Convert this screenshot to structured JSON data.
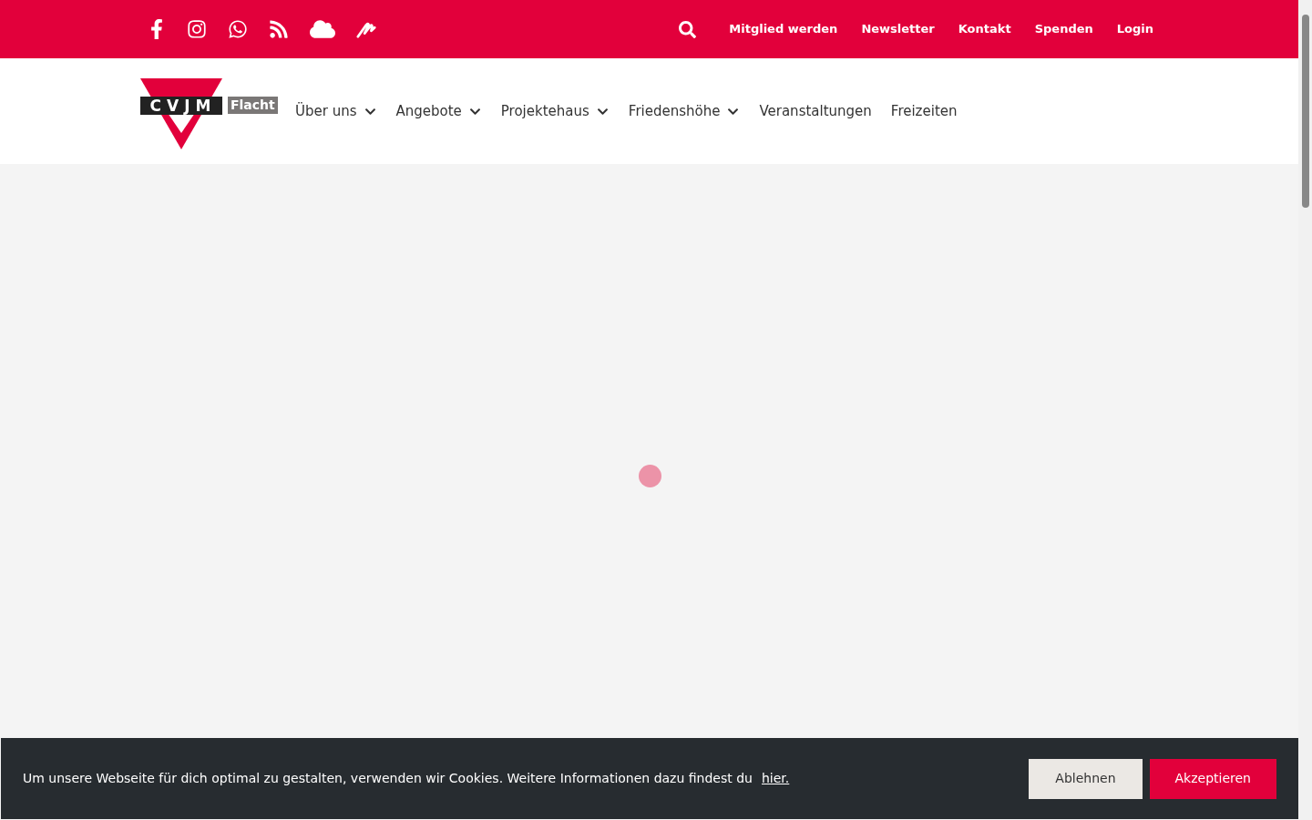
{
  "top_bar": {
    "social_icons": [
      {
        "kind": "facebook"
      },
      {
        "kind": "instagram"
      },
      {
        "kind": "whatsapp"
      },
      {
        "kind": "rss"
      },
      {
        "kind": "cloud"
      },
      {
        "kind": "signature"
      }
    ],
    "links": [
      "Mitglied werden",
      "Newsletter",
      "Kontakt",
      "Spenden",
      "Login"
    ]
  },
  "logo": {
    "mark": "CVJM",
    "place": "Flacht"
  },
  "nav": [
    {
      "label": "Über uns",
      "dropdown": true
    },
    {
      "label": "Angebote",
      "dropdown": true
    },
    {
      "label": "Projektehaus",
      "dropdown": true
    },
    {
      "label": "Friedenshöhe",
      "dropdown": true
    },
    {
      "label": "Veranstaltungen",
      "dropdown": false
    },
    {
      "label": "Freizeiten",
      "dropdown": false
    }
  ],
  "cookie_banner": {
    "text": "Um unsere Webseite für dich optimal zu gestalten, verwenden wir Cookies. Weitere Informationen dazu findest du",
    "link": "hier.",
    "buttons": [
      {
        "label": "Ablehnen",
        "kind": "secondary"
      },
      {
        "label": "Akzeptieren",
        "kind": "primary"
      }
    ]
  }
}
